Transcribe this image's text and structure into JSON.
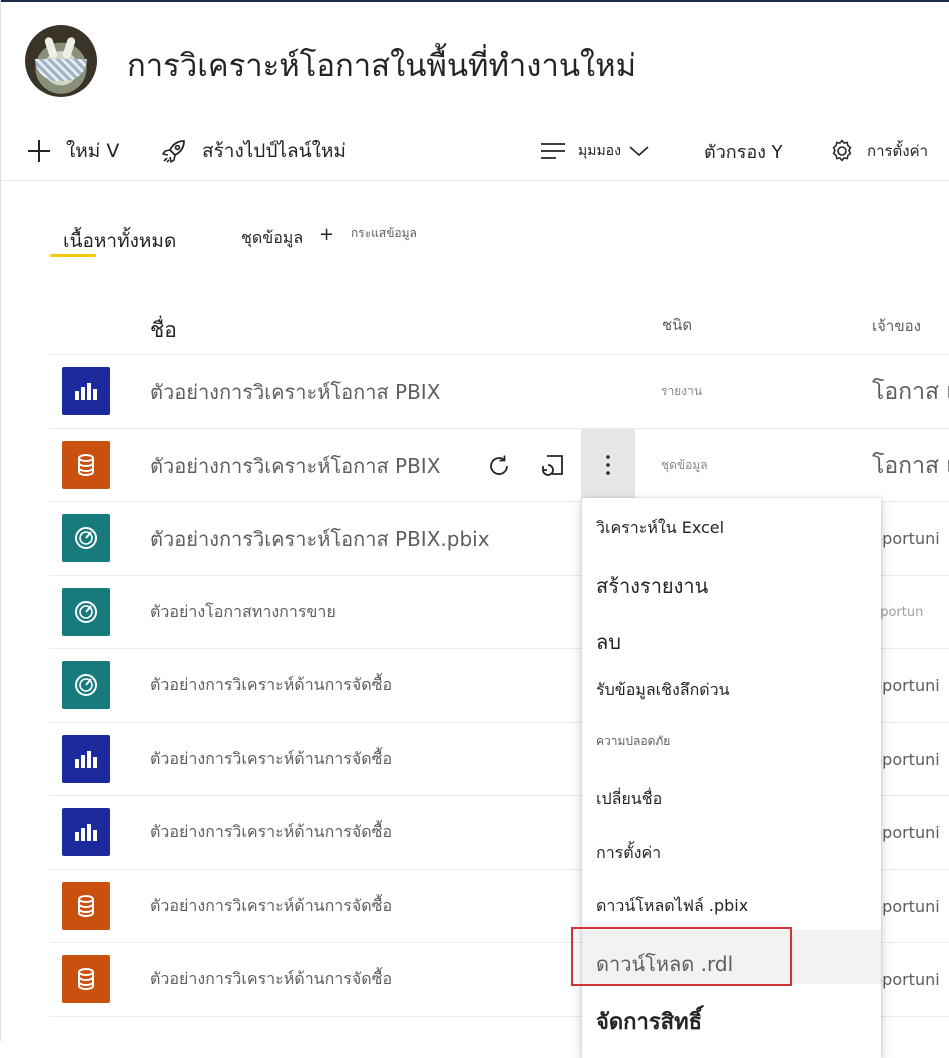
{
  "workspace": {
    "title": "การวิเคราะห์โอกาสในพื้นที่ทำงานใหม่"
  },
  "toolbar": {
    "new_label": "ใหม่ V",
    "pipeline_label": "สร้างไปป์ไลน์ใหม่",
    "view_label": "มุมมอง",
    "filter_label": "ตัวกรอง Y",
    "settings_label": "การตั้งค่า"
  },
  "tabs": {
    "all_content": "เนื้อหาทั้งหมด",
    "datasets": "ชุดข้อมูล",
    "plus": "+",
    "dataflows": "กระแสข้อมูล"
  },
  "columns": {
    "name": "ชื่อ",
    "type": "ชนิด",
    "owner": "เจ้าของ"
  },
  "rows": [
    {
      "icon": "report-icon",
      "name": "ตัวอย่างการวิเคราะห์โอกาส PBIX",
      "type": "รายงาน",
      "owner": "โอกาส เ"
    },
    {
      "icon": "dataset-icon",
      "name": "ตัวอย่างการวิเคราะห์โอกาส PBIX",
      "type": "ชุดข้อมูล",
      "owner": "โอกาส เ"
    },
    {
      "icon": "dashboard-icon",
      "name": "ตัวอย่างการวิเคราะห์โอกาส PBIX.pbix",
      "type": "",
      "owner": "pportuni"
    },
    {
      "icon": "dashboard-icon",
      "name": "ตัวอย่างโอกาสทางการขาย",
      "type": "",
      "owner": "pportun"
    },
    {
      "icon": "dashboard-icon",
      "name": "ตัวอย่างการวิเคราะห์ด้านการจัดซื้อ",
      "type": "",
      "owner": "pportuni"
    },
    {
      "icon": "report-icon",
      "name": "ตัวอย่างการวิเคราะห์ด้านการจัดซื้อ",
      "type": "",
      "owner": "pportuni"
    },
    {
      "icon": "report-icon",
      "name": "ตัวอย่างการวิเคราะห์ด้านการจัดซื้อ",
      "type": "",
      "owner": "pportuni"
    },
    {
      "icon": "dataset-icon",
      "name": "ตัวอย่างการวิเคราะห์ด้านการจัดซื้อ",
      "type": "",
      "owner": "pportuni"
    },
    {
      "icon": "dataset-icon",
      "name": "ตัวอย่างการวิเคราะห์ด้านการจัดซื้อ",
      "type": "",
      "owner": "pportuni"
    }
  ],
  "menu": {
    "items": [
      "วิเคราะห์ใน Excel",
      "สร้างรายงาน",
      "ลบ",
      "รับข้อมูลเชิงลึกด่วน",
      "ความปลอดภัย",
      "เปลี่ยนชื่อ",
      "การตั้งค่า",
      "ดาวน์โหลดไฟล์ .pbix",
      "ดาวน์โหลด .rdl",
      "จัดการสิทธิ์"
    ]
  },
  "colors": {
    "report": "#1d2a9e",
    "dataset": "#ca5010",
    "dashboard": "#177a7d",
    "tab_accent": "#f2c811",
    "highlight_box": "#d13438"
  }
}
